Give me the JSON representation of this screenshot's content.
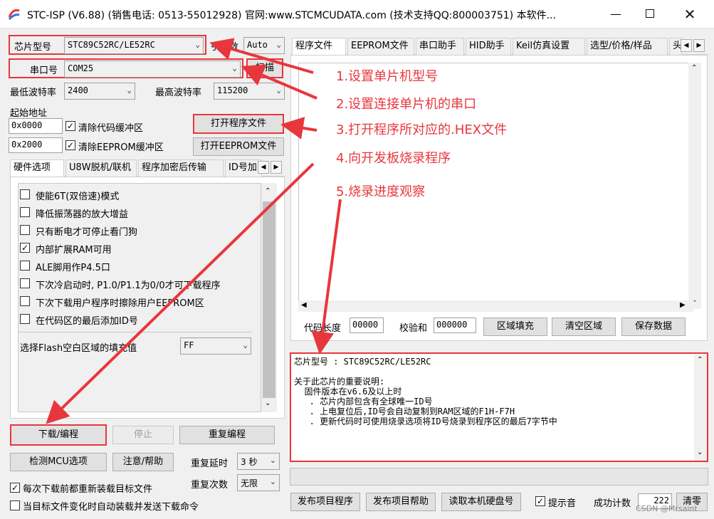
{
  "window": {
    "title": "STC-ISP (V6.88) (销售电话: 0513-55012928) 官网:www.STCMCUDATA.com  (技术支持QQ:800003751) 本软件...",
    "icons": [
      "app-logo-icon",
      "minimize-icon",
      "maximize-icon",
      "close-icon"
    ]
  },
  "left": {
    "chip_label": "芯片型号",
    "chip_value": "STC89C52RC/LE52RC",
    "pin_label": "引脚数",
    "pin_value": "Auto",
    "port_label": "串口号",
    "port_value": "COM25",
    "scan_button": "扫描",
    "min_baud_label": "最低波特率",
    "min_baud_value": "2400",
    "max_baud_label": "最高波特率",
    "max_baud_value": "115200",
    "start_addr_label": "起始地址",
    "addr1": "0x0000",
    "clear_code_label": "清除代码缓冲区",
    "open_prog_button": "打开程序文件",
    "addr2": "0x2000",
    "clear_eeprom_label": "清除EEPROM缓冲区",
    "open_eeprom_button": "打开EEPROM文件",
    "hw_tabs": [
      "硬件选项",
      "U8W脱机/联机",
      "程序加密后传输",
      "ID号加"
    ],
    "options": [
      {
        "label": "使能6T(双倍速)模式",
        "checked": false,
        "mark": ""
      },
      {
        "label": "降低振荡器的放大增益",
        "checked": false,
        "mark": ""
      },
      {
        "label": "只有断电才可停止看门狗",
        "checked": false,
        "mark": ""
      },
      {
        "label": "内部扩展RAM可用",
        "checked": true,
        "mark": "✓"
      },
      {
        "label": "ALE脚用作P4.5口",
        "checked": false,
        "mark": ""
      },
      {
        "label": "下次冷启动时, P1.0/P1.1为0/0才可下载程序",
        "checked": false,
        "mark": ""
      },
      {
        "label": "下次下载用户程序时擦除用户EEPROM区",
        "checked": false,
        "mark": ""
      },
      {
        "label": "在代码区的最后添加ID号",
        "checked": false,
        "mark": ""
      }
    ],
    "fill_label": "选择Flash空白区域的填充值",
    "fill_value": "FF",
    "download_button": "下载/编程",
    "stop_button": "停止",
    "repeat_button": "重复编程",
    "detect_button": "检测MCU选项",
    "help_button": "注意/帮助",
    "delay_label": "重复延时",
    "delay_value": "3 秒",
    "count_label": "重复次数",
    "count_value": "无限",
    "reload_label": "每次下载前都重新装载目标文件",
    "auto_label": "当目标文件变化时自动装载并发送下载命令"
  },
  "right": {
    "tabs": [
      "程序文件",
      "EEPROM文件",
      "串口助手",
      "HID助手",
      "Keil仿真设置",
      "选型/价格/样品",
      "头"
    ],
    "code_len_label": "代码长度",
    "code_len_value": "00000",
    "checksum_label": "校验和",
    "checksum_value": "000000",
    "fill_button": "区域填充",
    "clear_button": "清空区域",
    "save_button": "保存数据",
    "log_text": "芯片型号 : STC89C52RC/LE52RC\n\n关于此芯片的重要说明:\n  固件版本在v6.6及以上时\n   . 芯片内部包含有全球唯一ID号\n   . 上电复位后,ID号会自动复制到RAM区域的F1H-F7H\n   . 更新代码时可使用烧录选项将ID号烧录到程序区的最后7字节中",
    "publish_prog_button": "发布项目程序",
    "publish_help_button": "发布项目帮助",
    "read_disk_button": "读取本机硬盘号",
    "sound_label": "提示音",
    "success_label": "成功计数",
    "success_value": "222",
    "clear_count_button": "清零",
    "progress": 0
  },
  "annotations": {
    "a1": "1.设置单片机型号",
    "a2": "2.设置连接单片机的串口",
    "a3": "3.打开程序所对应的.HEX文件",
    "a4": "4.向开发板烧录程序",
    "a5": "5.烧录进度观察",
    "color": "#e8363d"
  },
  "watermark": "CSDN @Mrsaint"
}
